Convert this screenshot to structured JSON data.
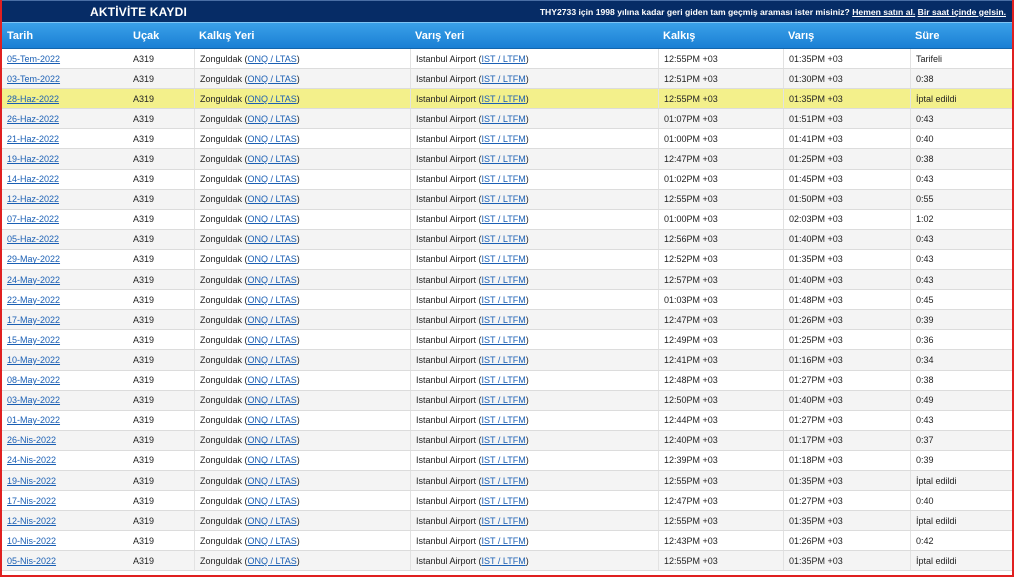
{
  "topbar": {
    "title": "AKTİVİTE KAYDI",
    "promo_text": "THY2733 için 1998 yılına kadar geri giden tam geçmiş araması ister misiniz?",
    "promo_link1": "Hemen satın al.",
    "promo_link2": "Bir saat içinde gelsin."
  },
  "table": {
    "headers": [
      "Tarih",
      "Uçak",
      "Kalkış Yeri",
      "Varış Yeri",
      "Kalkış",
      "Varış",
      "Süre"
    ],
    "origin_city": "Zonguldak",
    "origin_code": "ONQ / LTAS",
    "dest_city": "Istanbul Airport",
    "dest_code": "IST / LTFM",
    "rows": [
      {
        "date": "05-Tem-2022",
        "aircraft": "A319",
        "dep": "12:55PM +03",
        "arr": "01:35PM +03",
        "dur": "Tarifeli"
      },
      {
        "date": "03-Tem-2022",
        "aircraft": "A319",
        "dep": "12:51PM +03",
        "arr": "01:30PM +03",
        "dur": "0:38"
      },
      {
        "date": "28-Haz-2022",
        "aircraft": "A319",
        "dep": "12:55PM +03",
        "arr": "01:35PM +03",
        "dur": "İptal edildi",
        "highlight": true
      },
      {
        "date": "26-Haz-2022",
        "aircraft": "A319",
        "dep": "01:07PM +03",
        "arr": "01:51PM +03",
        "dur": "0:43"
      },
      {
        "date": "21-Haz-2022",
        "aircraft": "A319",
        "dep": "01:00PM +03",
        "arr": "01:41PM +03",
        "dur": "0:40"
      },
      {
        "date": "19-Haz-2022",
        "aircraft": "A319",
        "dep": "12:47PM +03",
        "arr": "01:25PM +03",
        "dur": "0:38"
      },
      {
        "date": "14-Haz-2022",
        "aircraft": "A319",
        "dep": "01:02PM +03",
        "arr": "01:45PM +03",
        "dur": "0:43"
      },
      {
        "date": "12-Haz-2022",
        "aircraft": "A319",
        "dep": "12:55PM +03",
        "arr": "01:50PM +03",
        "dur": "0:55"
      },
      {
        "date": "07-Haz-2022",
        "aircraft": "A319",
        "dep": "01:00PM +03",
        "arr": "02:03PM +03",
        "dur": "1:02"
      },
      {
        "date": "05-Haz-2022",
        "aircraft": "A319",
        "dep": "12:56PM +03",
        "arr": "01:40PM +03",
        "dur": "0:43"
      },
      {
        "date": "29-May-2022",
        "aircraft": "A319",
        "dep": "12:52PM +03",
        "arr": "01:35PM +03",
        "dur": "0:43"
      },
      {
        "date": "24-May-2022",
        "aircraft": "A319",
        "dep": "12:57PM +03",
        "arr": "01:40PM +03",
        "dur": "0:43"
      },
      {
        "date": "22-May-2022",
        "aircraft": "A319",
        "dep": "01:03PM +03",
        "arr": "01:48PM +03",
        "dur": "0:45"
      },
      {
        "date": "17-May-2022",
        "aircraft": "A319",
        "dep": "12:47PM +03",
        "arr": "01:26PM +03",
        "dur": "0:39"
      },
      {
        "date": "15-May-2022",
        "aircraft": "A319",
        "dep": "12:49PM +03",
        "arr": "01:25PM +03",
        "dur": "0:36"
      },
      {
        "date": "10-May-2022",
        "aircraft": "A319",
        "dep": "12:41PM +03",
        "arr": "01:16PM +03",
        "dur": "0:34"
      },
      {
        "date": "08-May-2022",
        "aircraft": "A319",
        "dep": "12:48PM +03",
        "arr": "01:27PM +03",
        "dur": "0:38"
      },
      {
        "date": "03-May-2022",
        "aircraft": "A319",
        "dep": "12:50PM +03",
        "arr": "01:40PM +03",
        "dur": "0:49"
      },
      {
        "date": "01-May-2022",
        "aircraft": "A319",
        "dep": "12:44PM +03",
        "arr": "01:27PM +03",
        "dur": "0:43"
      },
      {
        "date": "26-Nis-2022",
        "aircraft": "A319",
        "dep": "12:40PM +03",
        "arr": "01:17PM +03",
        "dur": "0:37"
      },
      {
        "date": "24-Nis-2022",
        "aircraft": "A319",
        "dep": "12:39PM +03",
        "arr": "01:18PM +03",
        "dur": "0:39"
      },
      {
        "date": "19-Nis-2022",
        "aircraft": "A319",
        "dep": "12:55PM +03",
        "arr": "01:35PM +03",
        "dur": "İptal edildi"
      },
      {
        "date": "17-Nis-2022",
        "aircraft": "A319",
        "dep": "12:47PM +03",
        "arr": "01:27PM +03",
        "dur": "0:40"
      },
      {
        "date": "12-Nis-2022",
        "aircraft": "A319",
        "dep": "12:55PM +03",
        "arr": "01:35PM +03",
        "dur": "İptal edildi"
      },
      {
        "date": "10-Nis-2022",
        "aircraft": "A319",
        "dep": "12:43PM +03",
        "arr": "01:26PM +03",
        "dur": "0:42"
      },
      {
        "date": "05-Nis-2022",
        "aircraft": "A319",
        "dep": "12:55PM +03",
        "arr": "01:35PM +03",
        "dur": "İptal edildi"
      }
    ]
  }
}
